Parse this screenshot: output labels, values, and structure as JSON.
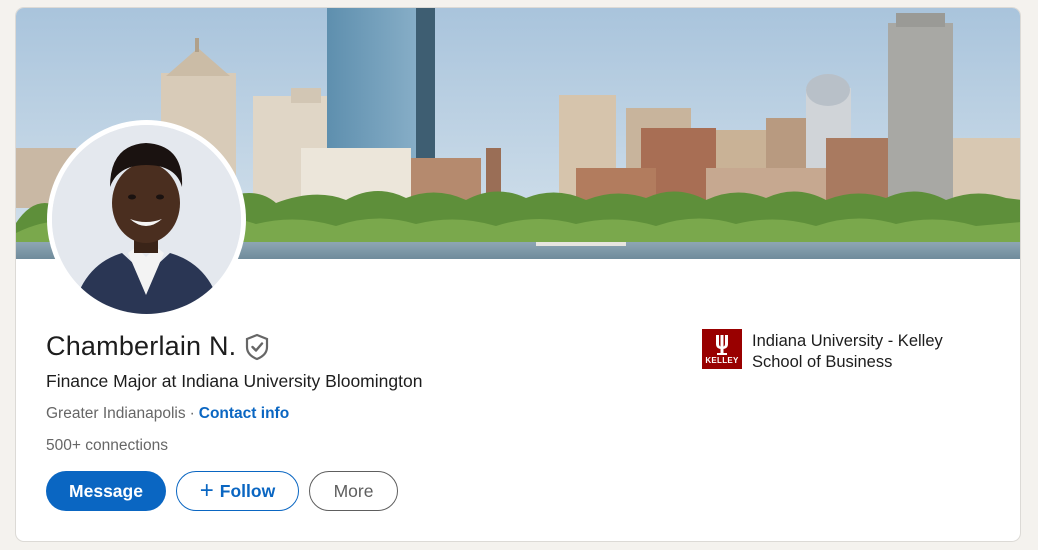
{
  "profile": {
    "name": "Chamberlain N.",
    "headline": "Finance Major at Indiana University Bloomington",
    "location": "Greater Indianapolis",
    "separator": "·",
    "contact_label": "Contact info",
    "connections": "500+ connections",
    "verified_icon": "verified-shield-icon"
  },
  "actions": {
    "message_label": "Message",
    "follow_label": "Follow",
    "more_label": "More"
  },
  "education": {
    "school_name": "Indiana University - Kelley School of Business",
    "logo_text": "KELLEY",
    "logo_color": "#990000"
  },
  "colors": {
    "accent": "#0a66c2"
  }
}
